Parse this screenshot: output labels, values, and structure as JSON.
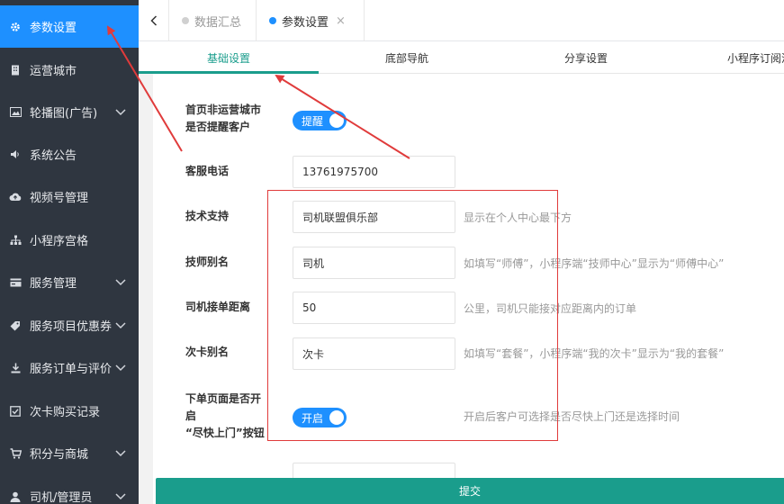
{
  "sidebar": {
    "items": [
      {
        "label": "参数设置",
        "icon": "gear-icon",
        "active": true,
        "has_arrow": false
      },
      {
        "label": "运营城市",
        "icon": "building-icon",
        "active": false,
        "has_arrow": false
      },
      {
        "label": "轮播图(广告)",
        "icon": "image-icon",
        "active": false,
        "has_arrow": true
      },
      {
        "label": "系统公告",
        "icon": "speaker-icon",
        "active": false,
        "has_arrow": false
      },
      {
        "label": "视频号管理",
        "icon": "cloud-upload-icon",
        "active": false,
        "has_arrow": false
      },
      {
        "label": "小程序宫格",
        "icon": "sitemap-icon",
        "active": false,
        "has_arrow": false
      },
      {
        "label": "服务管理",
        "icon": "card-icon",
        "active": false,
        "has_arrow": true
      },
      {
        "label": "服务项目优惠券",
        "icon": "tag-icon",
        "active": false,
        "has_arrow": true
      },
      {
        "label": "服务订单与评价",
        "icon": "download-icon",
        "active": false,
        "has_arrow": true
      },
      {
        "label": "次卡购买记录",
        "icon": "check-square-icon",
        "active": false,
        "has_arrow": false
      },
      {
        "label": "积分与商城",
        "icon": "cart-icon",
        "active": false,
        "has_arrow": true
      },
      {
        "label": "司机/管理员",
        "icon": "user-icon",
        "active": false,
        "has_arrow": true
      }
    ]
  },
  "tabs": [
    {
      "label": "数据汇总"
    },
    {
      "label": "参数设置",
      "close": "×"
    }
  ],
  "subtabs": [
    "基础设置",
    "底部导航",
    "分享设置",
    "小程序订阅消"
  ],
  "form": {
    "fields": [
      {
        "label": "首页非运营城市\n是否提醒客户",
        "type": "switch",
        "value": "提醒",
        "hint": ""
      },
      {
        "label": "客服电话",
        "type": "input",
        "value": "13761975700",
        "hint": ""
      },
      {
        "label": "技术支持",
        "type": "input",
        "value": "司机联盟俱乐部",
        "hint": "显示在个人中心最下方"
      },
      {
        "label": "技师别名",
        "type": "input",
        "value": "司机",
        "hint": "如填写“师傅”，小程序端“技师中心”显示为“师傅中心”"
      },
      {
        "label": "司机接单距离",
        "type": "input",
        "value": "50",
        "hint": "公里，司机只能接对应距离内的订单"
      },
      {
        "label": "次卡别名",
        "type": "input",
        "value": "次卡",
        "hint": "如填写“套餐”，小程序端“我的次卡”显示为“我的套餐”"
      },
      {
        "label": "下单页面是否开\n启\n“尽快上门”按钮",
        "type": "switch",
        "value": "开启",
        "hint": "开启后客户可选择是否尽快上门还是选择时间"
      }
    ]
  },
  "submit_label": "提交",
  "colors": {
    "sidebar_bg": "#2f3640",
    "active_blue": "#1e90ff",
    "teal": "#1a9d8c",
    "annotation_red": "#e03b3b"
  }
}
